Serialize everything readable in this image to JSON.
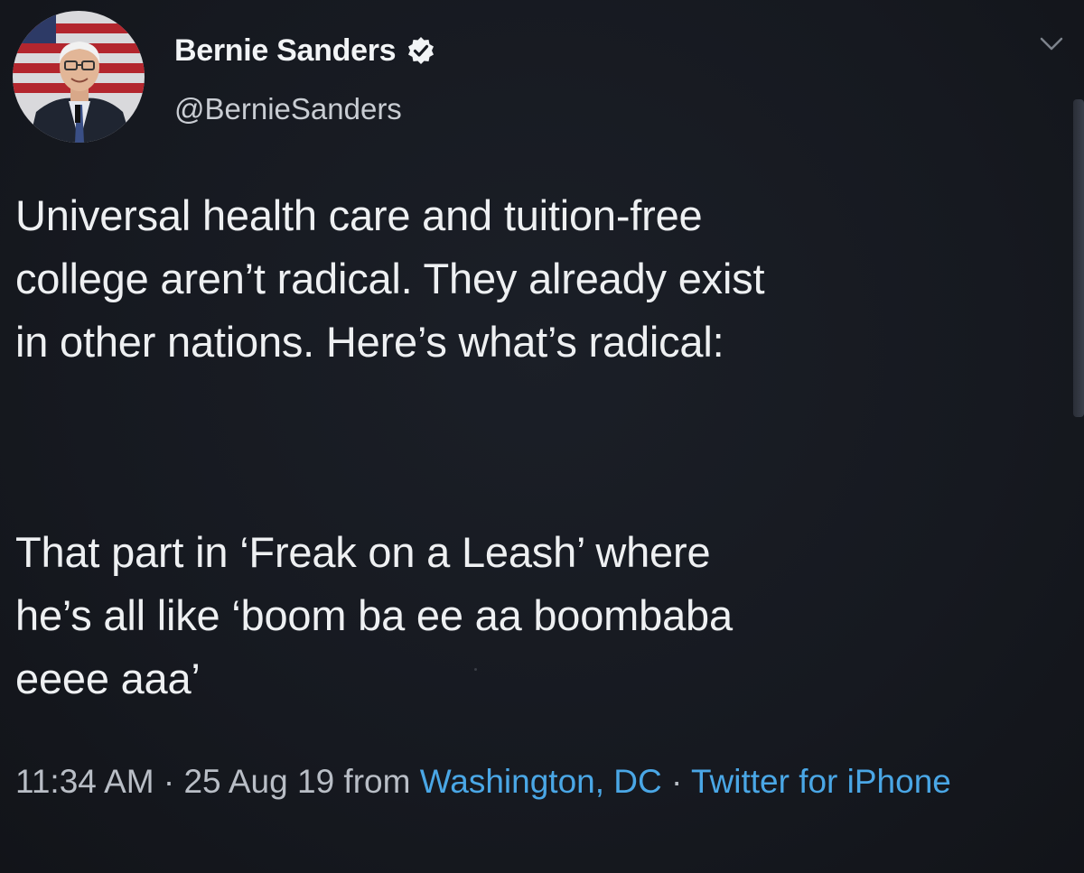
{
  "tweet": {
    "author": {
      "display_name": "Bernie Sanders",
      "handle": "@BernieSanders",
      "verified": true,
      "avatar": "avatar-photo"
    },
    "menu_icon": "chevron-down-icon",
    "text_paragraph_1": "Universal health care and tuition-free\ncollege aren’t radical. They already exist\nin other nations. Here’s what’s radical:",
    "text_paragraph_2": "That part in ‘Freak on a Leash’ where\nhe’s all like ‘boom ba ee aa boombaba\neeee aaa’",
    "meta": {
      "time": "11:34 AM",
      "separator": " · ",
      "date": "25 Aug 19",
      "from_word": " from ",
      "location": "Washington, DC",
      "source": "Twitter for iPhone"
    }
  },
  "colors": {
    "background": "#15181f",
    "text": "#eef0f2",
    "secondary_text": "#b9bec6",
    "link": "#4aa7e6"
  }
}
